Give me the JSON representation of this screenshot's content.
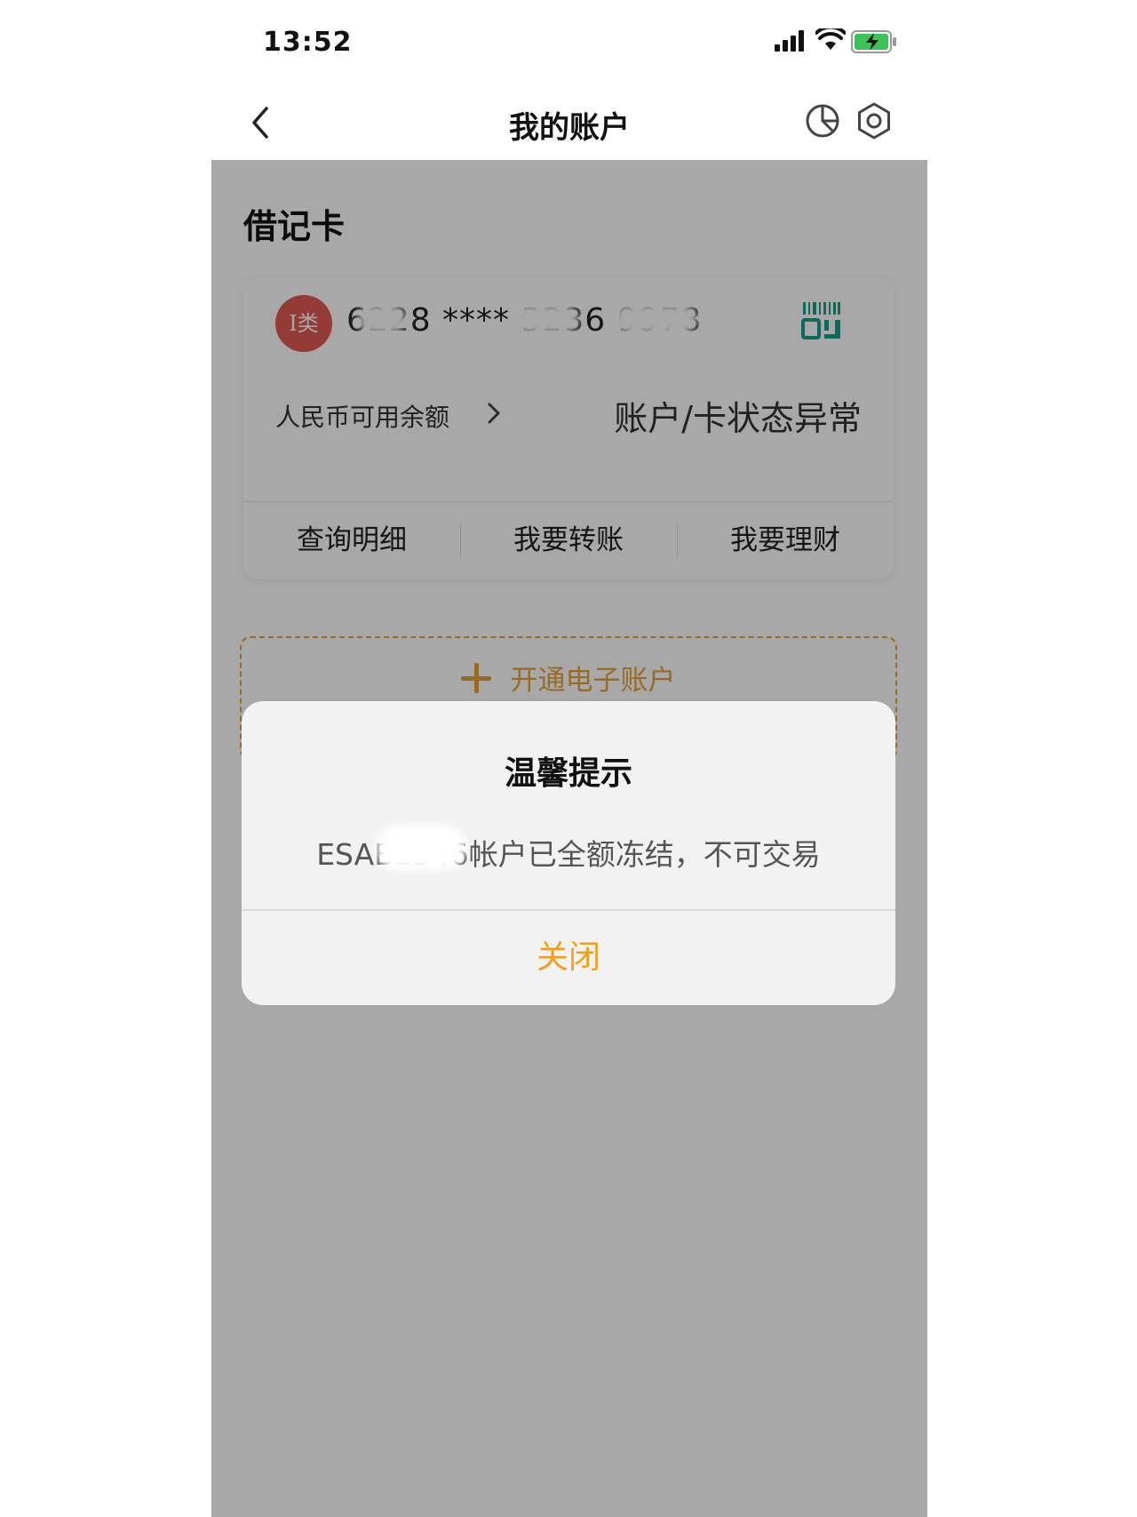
{
  "status_bar": {
    "time": "13:52",
    "icons": [
      "signal-icon",
      "wifi-icon",
      "battery-charging-icon"
    ]
  },
  "nav": {
    "title": "我的账户",
    "icons": [
      "back-icon",
      "chart-icon",
      "gear-icon"
    ]
  },
  "section": {
    "title": "借记卡"
  },
  "card": {
    "type_badge": "I类",
    "number_masked": "6228 **** 5236 9978",
    "balance_label": "人民币可用余额",
    "status_text": "账户/卡状态异常",
    "actions": [
      "查询明细",
      "我要转账",
      "我要理财"
    ],
    "qr_icon": "qrcode-icon"
  },
  "open_eaccount": {
    "label": "开通电子账户"
  },
  "dialog": {
    "title": "温馨提示",
    "message": "ESAB2346帐户已全额冻结，不可交易",
    "close_label": "关闭"
  },
  "colors": {
    "accent": "#f0a020",
    "badge_red": "#e15a56",
    "qr_green": "#1e9e8c",
    "overlay": "rgba(0,0,0,0.34)"
  }
}
